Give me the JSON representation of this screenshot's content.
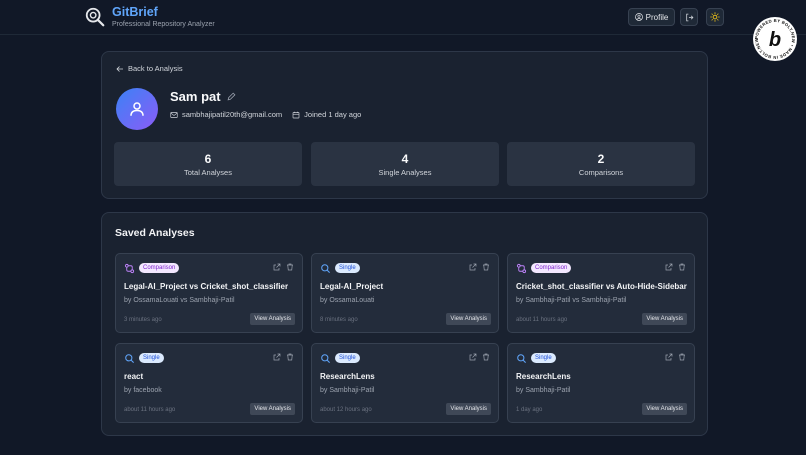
{
  "header": {
    "app_name": "GitBrief",
    "tagline": "Professional Repository Analyzer",
    "profile_label": "Profile",
    "logout_icon": "logout-icon",
    "theme_icon": "sun-icon",
    "badge_text": "POWERED BY BOLT.NEW MADE IN BOLT.NEW",
    "badge_letter": "b"
  },
  "profile": {
    "back_label": "Back to Analysis",
    "name": "Sam pat",
    "email": "sambhajipatil20th@gmail.com",
    "joined": "Joined 1 day ago",
    "stats": [
      {
        "value": "6",
        "label": "Total Analyses"
      },
      {
        "value": "4",
        "label": "Single Analyses"
      },
      {
        "value": "2",
        "label": "Comparisons"
      }
    ]
  },
  "saved": {
    "title": "Saved Analyses",
    "view_label": "View Analysis",
    "items": [
      {
        "type": "Comparison",
        "title": "Legal-AI_Project vs Cricket_shot_classifier",
        "by": "by OssamaLouati vs Sambhaji-Patil",
        "time": "3 minutes ago"
      },
      {
        "type": "Single",
        "title": "Legal-AI_Project",
        "by": "by OssamaLouati",
        "time": "8 minutes ago"
      },
      {
        "type": "Comparison",
        "title": "Cricket_shot_classifier vs Auto-Hide-Sidebar",
        "by": "by Sambhaji-Patil vs Sambhaji-Patil",
        "time": "about 11 hours ago"
      },
      {
        "type": "Single",
        "title": "react",
        "by": "by facebook",
        "time": "about 11 hours ago"
      },
      {
        "type": "Single",
        "title": "ResearchLens",
        "by": "by Sambhaji-Patil",
        "time": "about 12 hours ago"
      },
      {
        "type": "Single",
        "title": "ResearchLens",
        "by": "by Sambhaji-Patil",
        "time": "1 day ago"
      }
    ]
  },
  "colors": {
    "accent": "#60a5fa",
    "background": "#111827",
    "card": "#1a2230",
    "comparison_badge": "#f3e8ff",
    "single_badge": "#dbeafe"
  }
}
